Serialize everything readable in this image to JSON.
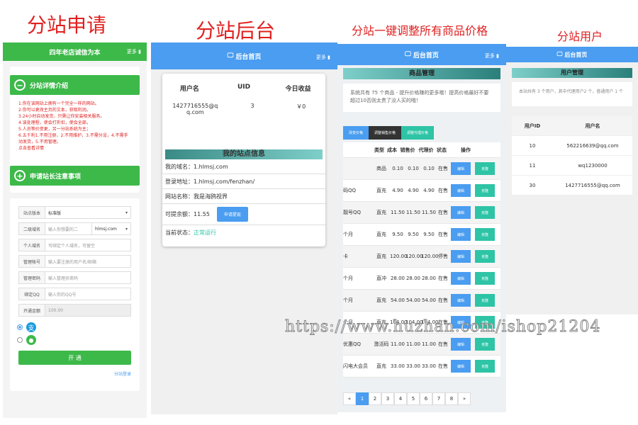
{
  "captions": [
    "分站申请",
    "分站后台",
    "分站一键调整所有商品价格",
    "分站用户"
  ],
  "apply": {
    "header": "四年老店诚信为本",
    "more": "更多",
    "intro_title": "分站详情介绍",
    "notes": [
      "1.你在该网站上拥有一个完全一样的网站。",
      "2.你可以更改主页的文本，获取利润。",
      "3.24小时自动发货，只需让你安装相关服务。",
      "4.该处理程，使会打折扣，使会全部。",
      "5.人员等价变更，另一分站系统为主；",
      "6.五千利1.不用注册，2.不用维护，3.不需分设，4.不需手动发货，5.不用管理。",
      "点击查看详情"
    ],
    "notice_title": "申请站长注意事项",
    "fields": [
      {
        "label": "站点版本",
        "value": "标准版"
      },
      {
        "label": "二级域名",
        "value": "输入你想要的二",
        "suffix": "hlmsj.com"
      },
      {
        "label": "个人域名",
        "value": "可绑定个人域名，可留空"
      },
      {
        "label": "管理帐号",
        "value": "输入要注册的用户名/邮箱"
      },
      {
        "label": "管理密码",
        "value": "输入管理员密码"
      },
      {
        "label": "绑定QQ",
        "value": "输入你的QQ号"
      },
      {
        "label": "开通金额",
        "value": "100.00"
      }
    ],
    "open_btn": "开 通",
    "login_link": "分站登录"
  },
  "backend": {
    "header": "后台首页",
    "more": "更多",
    "cols": [
      "用户名",
      "UID",
      "今日收益"
    ],
    "row": [
      "1427716555@qq.com",
      "3",
      "￥0"
    ],
    "site_title": "我的站点信息",
    "domain_label": "我的域名：",
    "domain": "1.hlmsj.com",
    "login_label": "登录地址：",
    "login": "1.hlmsj.com/fenzhan/",
    "name_label": "网站名称：",
    "name": "我是海鸥视界",
    "balance_label": "可提余额：",
    "balance": "11.55",
    "withdraw_btn": "申请提现",
    "status_label": "当前状态：",
    "status": "正常运行"
  },
  "products": {
    "header": "后台首页",
    "more": "更多",
    "title": "商品管理",
    "desc": "系统共有 75 个商品 - 提升价格赚的更多哦！提高价格最好不要超过10否则太贵了没人买的哦！",
    "buttons": [
      "改变价格",
      "调整销售价格",
      "调整代理价格"
    ],
    "cols": [
      "类型",
      "成本",
      "销售价",
      "代理价",
      "状态",
      "操作"
    ],
    "rows": [
      [
        "",
        "商品",
        "0.10",
        "0.10",
        "0.10",
        "在售"
      ],
      [
        "码QQ",
        "直充",
        "4.90",
        "4.90",
        "4.90",
        "在售"
      ],
      [
        "靓号QQ",
        "直充",
        "11.50",
        "11.50",
        "11.50",
        "在售"
      ],
      [
        "个月",
        "直充",
        "9.50",
        "9.50",
        "9.50",
        "在售"
      ],
      [
        "卡",
        "直充",
        "120.00",
        "120.00",
        "120.00",
        "停售"
      ],
      [
        "个月",
        "直冲",
        "28.00",
        "28.00",
        "28.00",
        "在售"
      ],
      [
        "个月",
        "直充",
        "54.00",
        "54.00",
        "54.00",
        "在售"
      ],
      [
        "个月",
        "直充",
        "104.00",
        "104.00",
        "104.00",
        "在售"
      ],
      [
        "优惠QQ",
        "激活码",
        "11.00",
        "11.00",
        "11.00",
        "在售"
      ],
      [
        "闪电大会员",
        "直充",
        "33.00",
        "33.00",
        "33.00",
        "在售"
      ]
    ],
    "edit": "编辑",
    "copy": "克隆",
    "pages": [
      "«",
      "1",
      "2",
      "3",
      "4",
      "5",
      "6",
      "7",
      "8",
      "»"
    ]
  },
  "users": {
    "header": "后台首页",
    "title": "用户管理",
    "desc": "本站共有 3 个用户，其中代理用户2 个，普通用户 1 个",
    "cols": [
      "用户ID",
      "用户名"
    ],
    "rows": [
      [
        "10",
        "562216639@qq.com"
      ],
      [
        "11",
        "wq1230000"
      ],
      [
        "30",
        "1427716555@qq.com"
      ]
    ]
  },
  "watermark": "https://www.huzhan.com/ishop21204",
  "colors": {
    "green": "#3db94a",
    "blue": "#4a9df0",
    "teal": "#2ec4a6",
    "red": "#e02020"
  }
}
